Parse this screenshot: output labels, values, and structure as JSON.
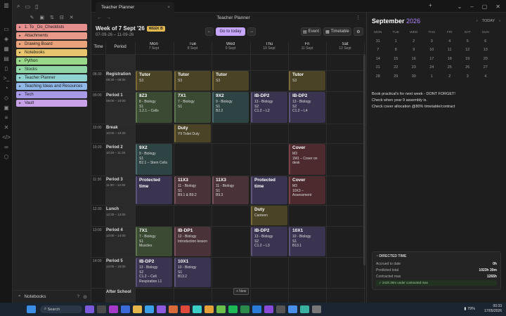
{
  "tab": {
    "title": "Teacher Planner",
    "close": "×",
    "plus": "+"
  },
  "view_title": "Teacher Planner",
  "sidebar": {
    "folders": [
      {
        "label": "1. To _Do_Checklists",
        "color": "#e58e8e",
        "icon": "checkbox-icon"
      },
      {
        "label": "Attachments",
        "color": "#e89a8a",
        "icon": "folder-icon"
      },
      {
        "label": "Drawing Board",
        "color": "#eaa27a",
        "icon": "folder-icon"
      },
      {
        "label": "Notebooks",
        "color": "#e8c56c",
        "icon": "folder-icon"
      },
      {
        "label": "Python",
        "color": "#9ad889",
        "icon": "folder-icon"
      },
      {
        "label": "Stocks",
        "color": "#8fd6a6",
        "icon": "folder-icon"
      },
      {
        "label": "Teacher Planner",
        "color": "#8fd3d0",
        "icon": "folder-icon"
      },
      {
        "label": "Teaching Ideas and Resources",
        "color": "#8fb7e8",
        "icon": "folder-icon"
      },
      {
        "label": "Tech",
        "color": "#a99ae8",
        "icon": "folder-icon"
      },
      {
        "label": "Vault",
        "color": "#c8a2e8",
        "icon": "folder-icon"
      }
    ],
    "vault_name": "Notebooks"
  },
  "week": {
    "title": "Week of 7 Sept '26",
    "badge": "WEEK B",
    "range": "07-09-26 – 11-09-26"
  },
  "buttons": {
    "prev": "←",
    "goto": "Go to today",
    "next": "→",
    "event": "Event",
    "timetable": "Timetable"
  },
  "grid": {
    "time_header": "Time",
    "period_header": "Period",
    "days": [
      {
        "name": "Mon",
        "date": "7 Sept"
      },
      {
        "name": "Tue",
        "date": "8 Sept"
      },
      {
        "name": "Wed",
        "date": "9 Sept"
      },
      {
        "name": "Thu",
        "date": "10 Sept"
      },
      {
        "name": "Fri",
        "date": "11 Sept"
      },
      {
        "name": "Sat",
        "date": "12 Sept"
      }
    ],
    "periods": [
      {
        "time": "08:30",
        "name": "Registration",
        "range": "08:30 – 09:00"
      },
      {
        "time": "09:00",
        "name": "Period 1",
        "range": "09:00 – 10:00"
      },
      {
        "time": "10:00",
        "name": "Break",
        "range": "10:00 – 10:20"
      },
      {
        "time": "10:20",
        "name": "Period 2",
        "range": "10:20 – 11:30"
      },
      {
        "time": "11:30",
        "name": "Period 3",
        "range": "11:30 – 12:30"
      },
      {
        "time": "12:30",
        "name": "Lunch",
        "range": "12:30 – 13:00"
      },
      {
        "time": "13:00",
        "name": "Period 4",
        "range": "13:00 – 14:00"
      },
      {
        "time": "14:00",
        "name": "Period 5",
        "range": "14:00 – 15:00"
      },
      {
        "time": "",
        "name": "After School",
        "range": ""
      }
    ],
    "add_label": "+ New"
  },
  "events": [
    {
      "t": "Tutor",
      "d": [
        "S3"
      ],
      "c": "#4a4326",
      "b": "#7a6a35"
    },
    {
      "t": "Tutor",
      "d": [
        "S3"
      ],
      "c": "#4a4326",
      "b": "#7a6a35"
    },
    {
      "t": "Tutor",
      "d": [
        "S3"
      ],
      "c": "#4a4326",
      "b": "#7a6a35"
    },
    {
      "t": "Tutor",
      "d": [
        "S3"
      ],
      "c": "#4a4326",
      "b": "#7a6a35"
    },
    {
      "t": "8Z3",
      "d": [
        "8 - Biology",
        "S1",
        "1.2.1 – Cells"
      ],
      "c": "#3a4a33",
      "b": "#5d7650"
    },
    {
      "t": "7X1",
      "d": [
        "7 - Biology",
        "S1"
      ],
      "c": "#3a4a33",
      "b": "#5d7650"
    },
    {
      "t": "9X2",
      "d": [
        "9 - Biology",
        "S1",
        "B2.2"
      ],
      "c": "#2e4344",
      "b": "#4a6a6c"
    },
    {
      "t": "IB-DP2",
      "d": [
        "13 - Biology",
        "S2",
        "C1.2 – L2"
      ],
      "c": "#3b3450",
      "b": "#5c527a"
    },
    {
      "t": "IB-DP2",
      "d": [
        "13 - Biology",
        "S2",
        "C1.2 – L4"
      ],
      "c": "#3b3450",
      "b": "#5c527a"
    },
    {
      "t": "Duty",
      "d": [
        "Y9 Toilet Duty"
      ],
      "c": "#4a4326",
      "b": "#7a6a35"
    },
    {
      "t": "9X2",
      "d": [
        "9 - Biology",
        "S1",
        "B2.1 – Stem Cells"
      ],
      "c": "#2e4344",
      "b": "#4a6a6c"
    },
    {
      "t": "Cover",
      "d": [
        "M3",
        "1M1 – Cover on desk"
      ],
      "c": "#4d2a2e",
      "b": "#7a4248"
    },
    {
      "t": "Protected time",
      "d": [],
      "c": "#3b3450",
      "b": "#5c527a"
    },
    {
      "t": "11X3",
      "d": [
        "11 - Biology",
        "S1",
        "B9.1 & B9.2"
      ],
      "c": "#4a3338",
      "b": "#754f57"
    },
    {
      "t": "11X3",
      "d": [
        "11 - Biology",
        "S1",
        "B9.3"
      ],
      "c": "#4a3338",
      "b": "#754f57"
    },
    {
      "t": "Protected time",
      "d": [],
      "c": "#3b3450",
      "b": "#5c527a"
    },
    {
      "t": "Cover",
      "d": [
        "M3",
        "10X3 – Assessment"
      ],
      "c": "#4d2a2e",
      "b": "#7a4248"
    },
    {
      "t": "Duty",
      "d": [
        "Canteen"
      ],
      "c": "#4a4326",
      "b": "#7a6a35"
    },
    {
      "t": "7X1",
      "d": [
        "7 - Biology",
        "S1",
        "Muscles"
      ],
      "c": "#3a4a33",
      "b": "#5d7650"
    },
    {
      "t": "IB-DP1",
      "d": [
        "12 - Biology",
        "Introduction lesson"
      ],
      "c": "#4a3338",
      "b": "#754f57"
    },
    {
      "t": "IB-DP2",
      "d": [
        "13 - Biology",
        "S2",
        "C1.2 – L3"
      ],
      "c": "#3b3450",
      "b": "#5c527a"
    },
    {
      "t": "10X1",
      "d": [
        "10 - Biology",
        "S1",
        "B13.1"
      ],
      "c": "#3b3450",
      "b": "#5c527a"
    },
    {
      "t": "IB-DP2",
      "d": [
        "13 - Biology",
        "S2",
        "C1.2 – Cell Respiration L1"
      ],
      "c": "#3b3450",
      "b": "#5c527a"
    },
    {
      "t": "10X1",
      "d": [
        "10 - Biology",
        "S1",
        "B13.2"
      ],
      "c": "#3b3450",
      "b": "#5c527a"
    }
  ],
  "calendar": {
    "month": "September",
    "year": "2026",
    "today_label": "TODAY",
    "prev": "‹",
    "next": "›",
    "days": [
      "MON",
      "TUE",
      "WED",
      "THU",
      "FRI",
      "SAT",
      "SUN"
    ],
    "weeks": [
      [
        "31",
        "1",
        "2",
        "3",
        "4",
        "5",
        "6"
      ],
      [
        "7",
        "8",
        "9",
        "10",
        "11",
        "12",
        "13"
      ],
      [
        "14",
        "15",
        "16",
        "17",
        "18",
        "19",
        "20"
      ],
      [
        "21",
        "22",
        "23",
        "24",
        "25",
        "26",
        "27"
      ],
      [
        "28",
        "29",
        "30",
        "1",
        "2",
        "3",
        "4"
      ]
    ]
  },
  "notes": [
    "Book practical's for next week - DONT FORGET!",
    "Check when year 9 assembly is.",
    "Check cover allocation @80% timetable/contract"
  ],
  "directed": {
    "title": "DIRECTED TIME",
    "rows": [
      {
        "k": "Accrued to date",
        "v": "0h"
      },
      {
        "k": "Predicted total",
        "v": "1023h 30m"
      },
      {
        "k": "Contracted max",
        "v": "1265h"
      }
    ],
    "ok": "241h 30m under contracted max"
  },
  "taskbar": {
    "search": "Search",
    "battery": "79%",
    "time": "00:33",
    "date": "17/05/2026",
    "lang": "ENG UK"
  }
}
